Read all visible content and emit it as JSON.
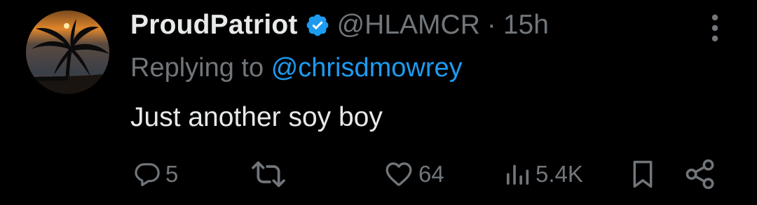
{
  "tweet": {
    "display_name": "ProudPatriot",
    "handle": "@HLAMCR",
    "separator": "·",
    "time": "15h",
    "replying_prefix": "Replying to",
    "replying_to": "@chrisdmowrey",
    "text": "Just another soy boy"
  },
  "actions": {
    "replies": "5",
    "retweets": "",
    "likes": "64",
    "views": "5.4K"
  },
  "icons": {
    "verified": "verified-badge-icon",
    "more": "more-options-icon",
    "reply": "reply-icon",
    "retweet": "retweet-icon",
    "like": "heart-icon",
    "views": "views-chart-icon",
    "bookmark": "bookmark-icon",
    "share": "share-icon"
  },
  "colors": {
    "background": "#000000",
    "primary_text": "#e7e9ea",
    "secondary_text": "#71767b",
    "link": "#1d9bf0",
    "verified": "#1d9bf0"
  }
}
